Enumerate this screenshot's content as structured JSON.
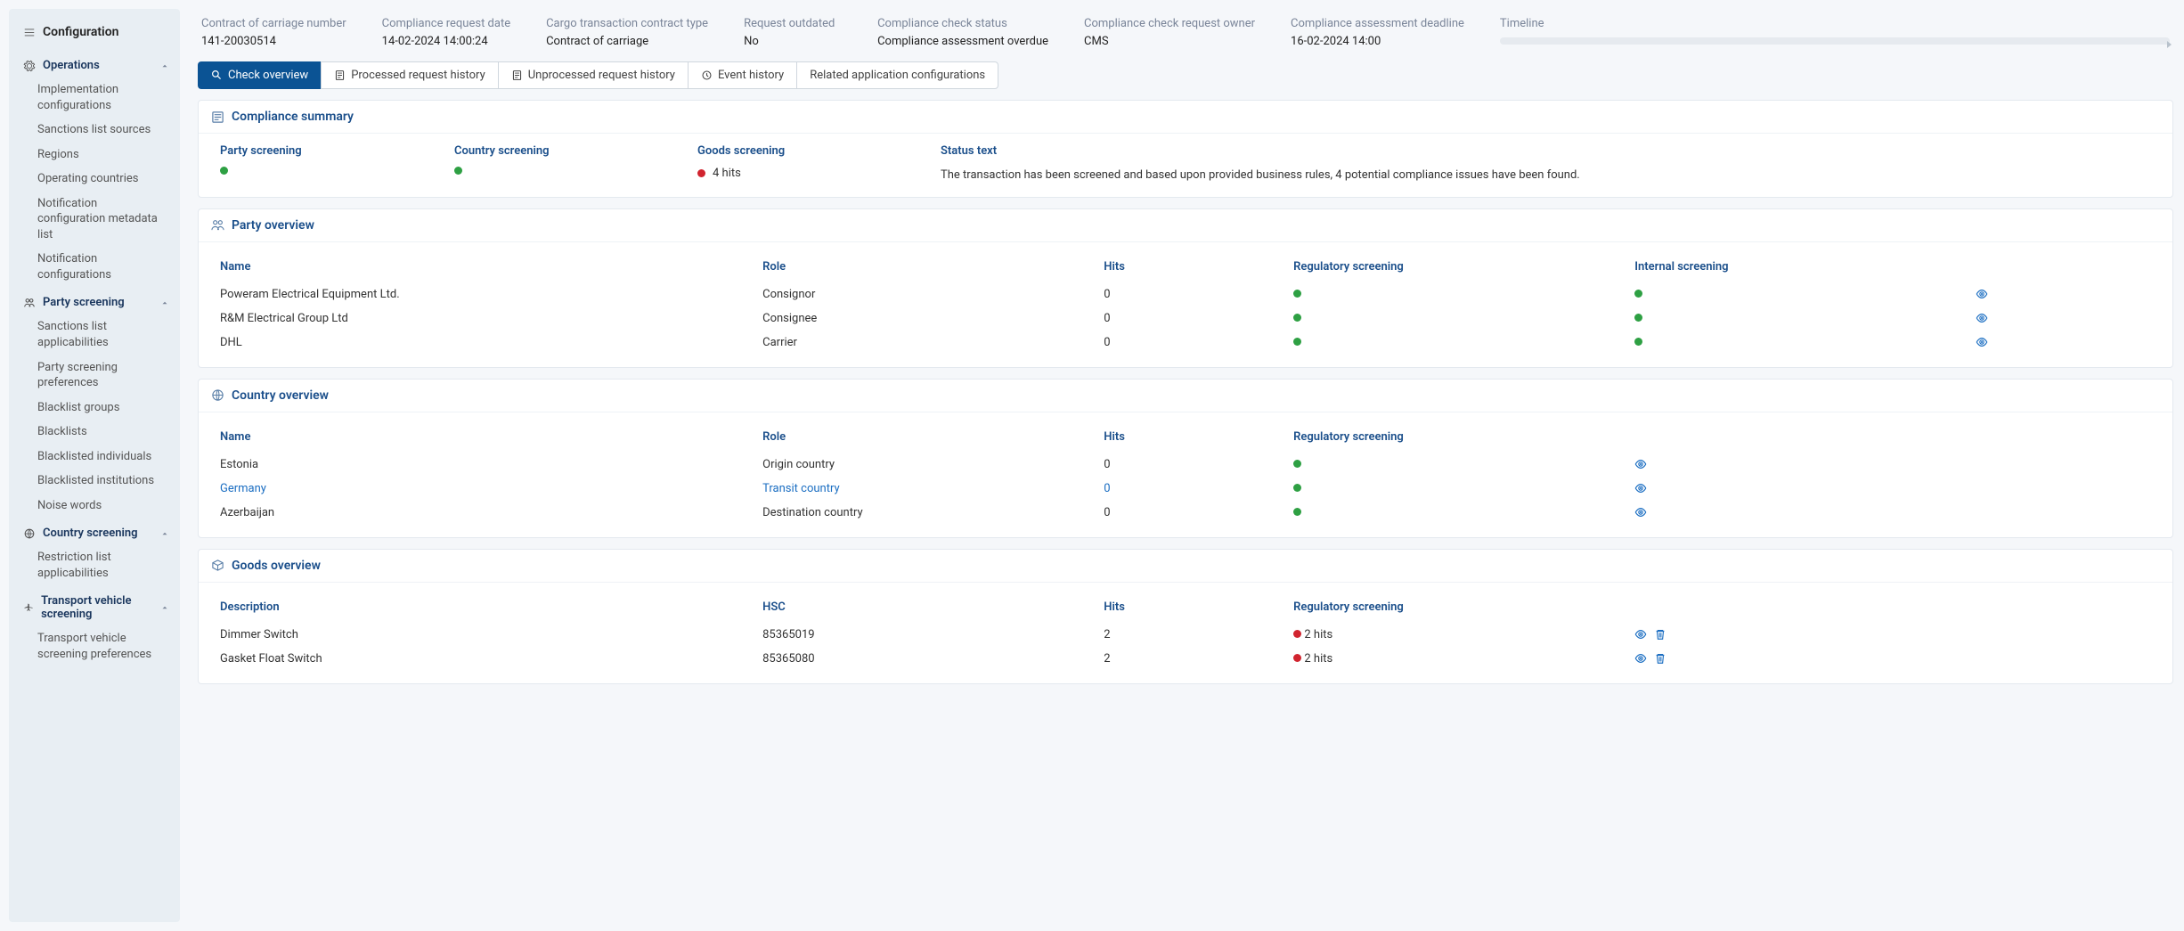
{
  "sidebar": {
    "configuration_label": "Configuration",
    "groups": [
      {
        "title": "Operations",
        "icon": "gear",
        "items": [
          "Implementation configurations",
          "Sanctions list sources",
          "Regions",
          "Operating countries",
          "Notification configuration metadata list",
          "Notification configurations"
        ]
      },
      {
        "title": "Party screening",
        "icon": "people",
        "items": [
          "Sanctions list applicabilities",
          "Party screening preferences",
          "Blacklist groups",
          "Blacklists",
          "Blacklisted individuals",
          "Blacklisted institutions",
          "Noise words"
        ]
      },
      {
        "title": "Country screening",
        "icon": "globe",
        "items": [
          "Restriction list applicabilities"
        ]
      },
      {
        "title": "Transport vehicle screening",
        "icon": "plane",
        "items": [
          "Transport vehicle screening preferences"
        ]
      }
    ]
  },
  "header": [
    {
      "label": "Contract of carriage number",
      "value": "141-20030514"
    },
    {
      "label": "Compliance request date",
      "value": "14-02-2024 14:00:24"
    },
    {
      "label": "Cargo transaction contract type",
      "value": "Contract of carriage"
    },
    {
      "label": "Request outdated",
      "value": "No"
    },
    {
      "label": "Compliance check status",
      "value": "Compliance assessment overdue"
    },
    {
      "label": "Compliance check request owner",
      "value": "CMS"
    },
    {
      "label": "Compliance assessment deadline",
      "value": "16-02-2024 14:00"
    }
  ],
  "timeline_label": "Timeline",
  "tabs": [
    {
      "label": "Check overview",
      "icon": "search",
      "active": true
    },
    {
      "label": "Processed request history",
      "icon": "doc"
    },
    {
      "label": "Unprocessed request history",
      "icon": "doc"
    },
    {
      "label": "Event history",
      "icon": "history"
    },
    {
      "label": "Related application configurations",
      "icon": ""
    }
  ],
  "compliance_summary": {
    "title": "Compliance summary",
    "party_label": "Party screening",
    "party_status": "green",
    "country_label": "Country screening",
    "country_status": "green",
    "goods_label": "Goods screening",
    "goods_status": "red",
    "goods_text": "4 hits",
    "status_label": "Status text",
    "status_text": "The transaction has been screened and based upon provided business rules, 4 potential compliance issues have been found."
  },
  "party_overview": {
    "title": "Party overview",
    "cols": {
      "name": "Name",
      "role": "Role",
      "hits": "Hits",
      "reg": "Regulatory screening",
      "int": "Internal screening"
    },
    "rows": [
      {
        "name": "Poweram Electrical Equipment Ltd.",
        "role": "Consignor",
        "hits": "0",
        "reg": "green",
        "int": "green"
      },
      {
        "name": "R&M Electrical Group Ltd",
        "role": "Consignee",
        "hits": "0",
        "reg": "green",
        "int": "green"
      },
      {
        "name": "DHL",
        "role": "Carrier",
        "hits": "0",
        "reg": "green",
        "int": "green"
      }
    ]
  },
  "country_overview": {
    "title": "Country overview",
    "cols": {
      "name": "Name",
      "role": "Role",
      "hits": "Hits",
      "reg": "Regulatory screening"
    },
    "rows": [
      {
        "name": "Estonia",
        "role": "Origin country",
        "hits": "0",
        "reg": "green",
        "highlight": false
      },
      {
        "name": "Germany",
        "role": "Transit country",
        "hits": "0",
        "reg": "green",
        "highlight": true
      },
      {
        "name": "Azerbaijan",
        "role": "Destination country",
        "hits": "0",
        "reg": "green",
        "highlight": false
      }
    ]
  },
  "goods_overview": {
    "title": "Goods overview",
    "cols": {
      "desc": "Description",
      "hsc": "HSC",
      "hits": "Hits",
      "reg": "Regulatory screening"
    },
    "rows": [
      {
        "desc": "Dimmer Switch",
        "hsc": "85365019",
        "hits": "2",
        "reg": "red",
        "reg_text": "2 hits"
      },
      {
        "desc": "Gasket Float Switch",
        "hsc": "85365080",
        "hits": "2",
        "reg": "red",
        "reg_text": "2 hits"
      }
    ]
  }
}
